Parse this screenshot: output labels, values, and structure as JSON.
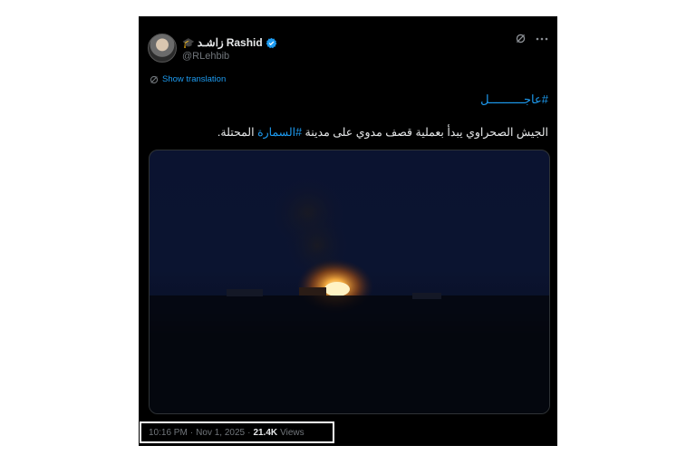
{
  "tweet": {
    "display_name": "Rashid",
    "display_name_arabic": "زاشـد",
    "handle": "@RLehbib",
    "show_translation": "Show translation",
    "hashtag_line": "#عاجــــــــــل",
    "text_prefix": "الجيش الصحراوي يبدأ بعملية قصف مدوي على مدينة ",
    "text_tag": "#السمارة",
    "text_suffix": " المحتلة.",
    "time": "10:16 PM",
    "date": "Nov 1, 2025",
    "views_count": "21.4K",
    "views_label": "Views",
    "separator": "·"
  },
  "colors": {
    "background": "#000000",
    "accent": "#1d9bf0",
    "text": "#e7e9ea",
    "muted": "#71767b"
  },
  "icons": [
    "verified-badge-icon",
    "grok-icon",
    "more-icon",
    "translate-icon"
  ]
}
